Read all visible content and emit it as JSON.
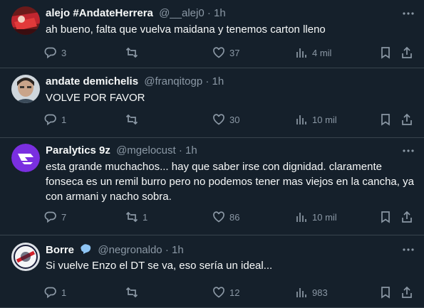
{
  "tweets": [
    {
      "name": "alejo #AndateHerrera",
      "handle": "@__alej0",
      "dot": "·",
      "time": "1h",
      "text": "ah bueno, falta que vuelva maidana y tenemos carton lleno",
      "replies": "3",
      "retweets": "",
      "likes": "37",
      "views": "4 mil",
      "avatar": "avatar-red-flag"
    },
    {
      "name": "andate demichelis",
      "handle": "@franqitogp",
      "dot": "·",
      "time": "1h",
      "text": "VOLVE POR FAVOR",
      "replies": "1",
      "retweets": "",
      "likes": "30",
      "views": "10 mil",
      "avatar": "avatar-person"
    },
    {
      "name": "Paralytics 9z",
      "handle": "@mgelocust",
      "dot": "·",
      "time": "1h",
      "text": "esta grande muchachos... hay que saber irse con dignidad. claramente fonseca es un remil burro pero no podemos tener mas viejos en la cancha, ya con armani y nacho sobra.",
      "replies": "7",
      "retweets": "1",
      "likes": "86",
      "views": "10 mil",
      "avatar": "avatar-purple-logo"
    },
    {
      "name": "Borre",
      "handle": "@negronaldo",
      "dot": "·",
      "time": "1h",
      "text": "Si vuelve Enzo el DT se va, eso sería un ideal...",
      "replies": "1",
      "retweets": "",
      "likes": "12",
      "views": "983",
      "avatar": "avatar-river-crest",
      "verified": true
    }
  ],
  "colors": {
    "background": "#15202b",
    "divider": "#38444d",
    "secondary_text": "#8b98a5",
    "verified": "#1d9bf0"
  }
}
